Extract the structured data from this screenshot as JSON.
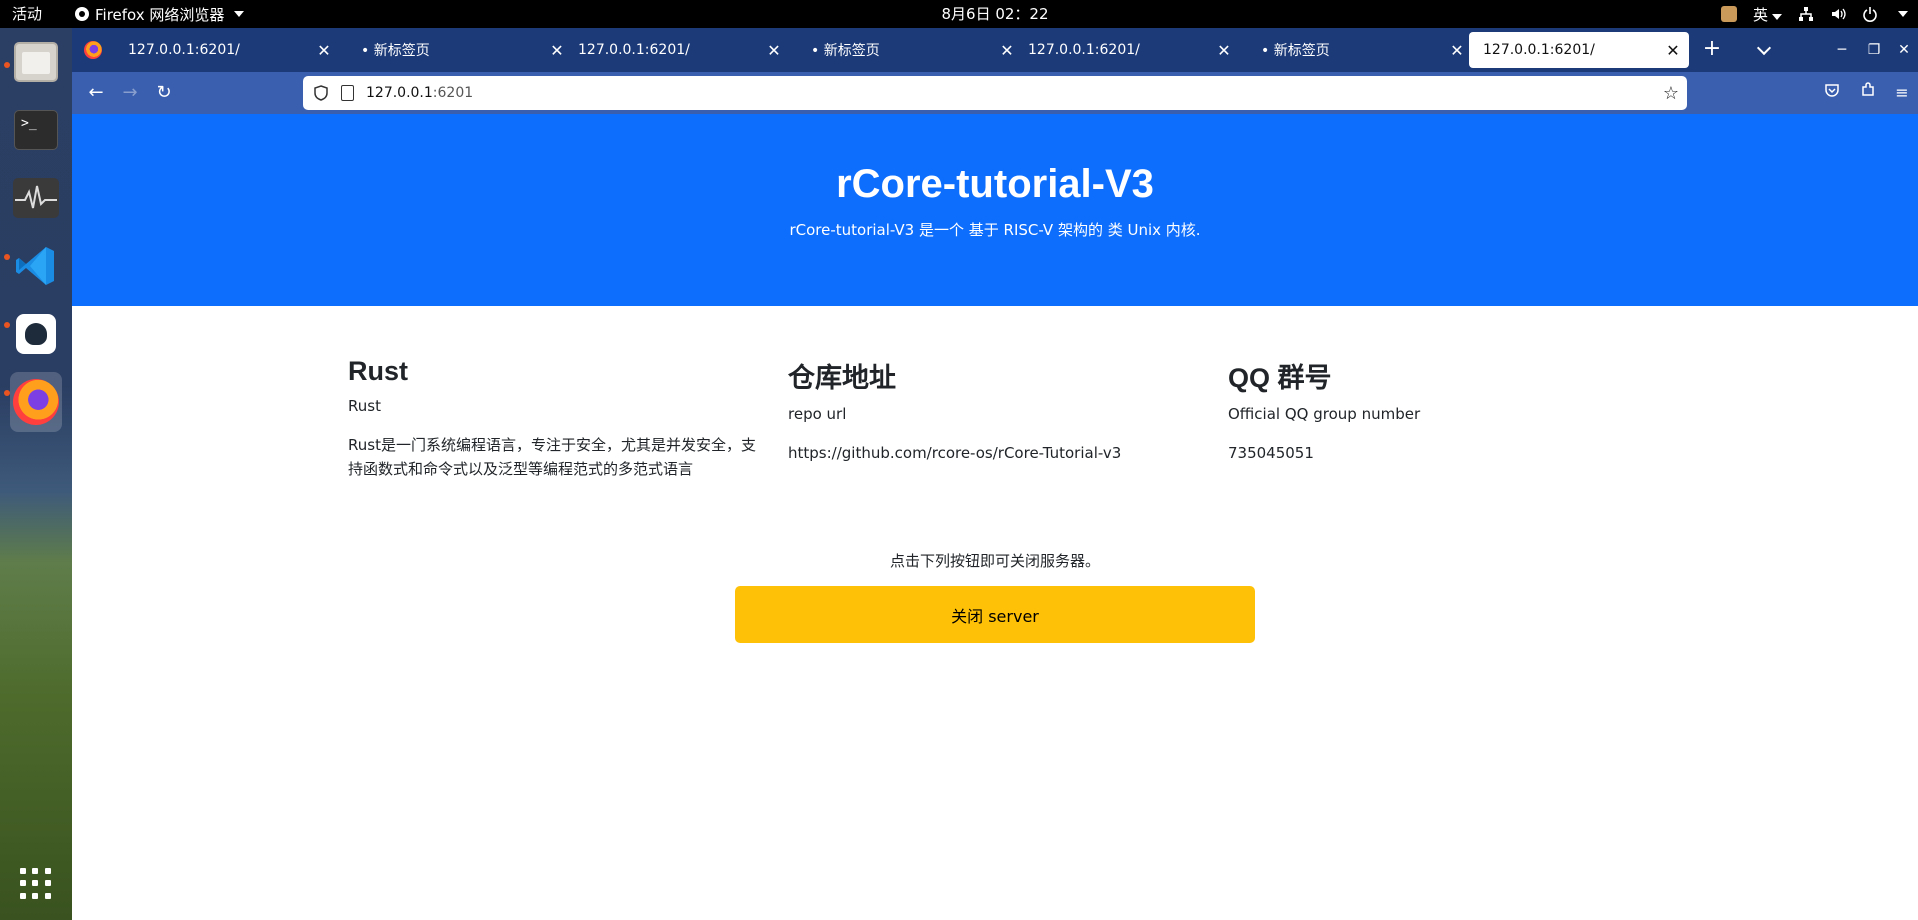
{
  "topbar": {
    "activities": "活动",
    "app_name": "Firefox 网络浏览器",
    "clock": "8月6日  02：22",
    "input_method": "英"
  },
  "dock": {
    "items": [
      "files",
      "terminal",
      "system-monitor",
      "vscode",
      "cat-app",
      "firefox"
    ],
    "show_apps": "grid-icon"
  },
  "browser": {
    "tabs": [
      {
        "label": "127.0.0.1:6201/"
      },
      {
        "label": "• 新标签页"
      },
      {
        "label": "127.0.0.1:6201/"
      },
      {
        "label": "• 新标签页"
      },
      {
        "label": "127.0.0.1:6201/"
      },
      {
        "label": "• 新标签页"
      },
      {
        "label": "127.0.0.1:6201/"
      }
    ],
    "url_host": "127.0.0.1",
    "url_port": ":6201"
  },
  "page": {
    "title": "rCore-tutorial-V3",
    "subtitle": "rCore-tutorial-V3 是一个 基于 RISC-V 架构的 类 Unix 内核.",
    "columns": [
      {
        "heading": "Rust",
        "sub": "Rust",
        "body": "Rust是一门系统编程语言，专注于安全，尤其是并发安全，支持函数式和命令式以及泛型等编程范式的多范式语言"
      },
      {
        "heading": "仓库地址",
        "sub": "repo url",
        "body": "https://github.com/rcore-os/rCore-Tutorial-v3"
      },
      {
        "heading": "QQ 群号",
        "sub": "Official QQ group number",
        "body": "735045051"
      }
    ],
    "notice": "点击下列按钮即可关闭服务器。",
    "button_label": "关闭 server"
  },
  "colors": {
    "hero": "#0d6efd",
    "button": "#ffc107",
    "tabstrip": "#1c3a78",
    "navbar": "#3a5fae"
  }
}
